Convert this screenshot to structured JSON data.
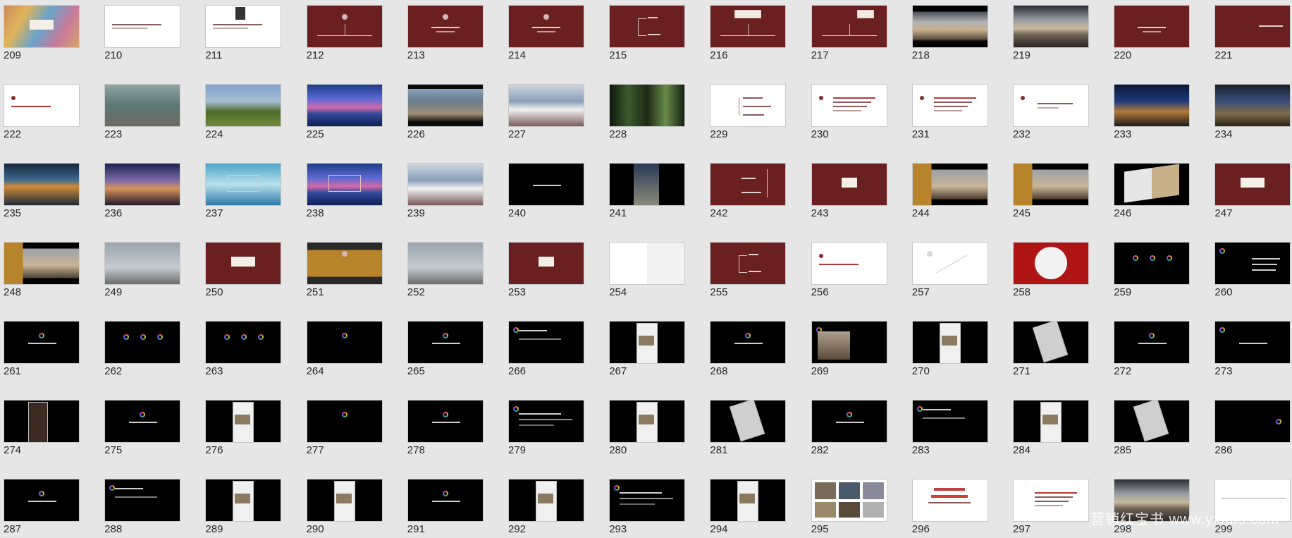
{
  "slides": [
    {
      "n": "209",
      "s": "colorful",
      "o": [
        "label-c"
      ]
    },
    {
      "n": "210",
      "s": "white",
      "o": [
        "text-l"
      ]
    },
    {
      "n": "211",
      "s": "white",
      "o": [
        "text-l",
        "photo-r"
      ]
    },
    {
      "n": "212",
      "s": "maroon",
      "o": [
        "logo-c",
        "tree"
      ]
    },
    {
      "n": "213",
      "s": "maroon",
      "o": [
        "logo-c",
        "text-c"
      ]
    },
    {
      "n": "214",
      "s": "maroon",
      "o": [
        "logo-c",
        "text-c"
      ]
    },
    {
      "n": "215",
      "s": "maroon",
      "o": [
        "branch"
      ]
    },
    {
      "n": "216",
      "s": "maroon",
      "o": [
        "box-top",
        "tree"
      ]
    },
    {
      "n": "217",
      "s": "maroon",
      "o": [
        "box-r",
        "tree"
      ]
    },
    {
      "n": "218",
      "s": "mtnblack",
      "o": []
    },
    {
      "n": "219",
      "s": "mountain",
      "o": []
    },
    {
      "n": "220",
      "s": "maroon",
      "o": [
        "text-c"
      ]
    },
    {
      "n": "221",
      "s": "maroon",
      "o": [
        "text-r"
      ]
    },
    {
      "n": "222",
      "s": "white",
      "o": [
        "logo-dark-l",
        "text-dark-l"
      ]
    },
    {
      "n": "223",
      "s": "bird",
      "o": []
    },
    {
      "n": "224",
      "s": "castle",
      "o": []
    },
    {
      "n": "225",
      "s": "sea",
      "o": []
    },
    {
      "n": "226",
      "s": "village",
      "o": []
    },
    {
      "n": "227",
      "s": "cloud",
      "o": []
    },
    {
      "n": "228",
      "s": "forest",
      "o": []
    },
    {
      "n": "229",
      "s": "white",
      "o": [
        "branch-dark"
      ]
    },
    {
      "n": "230",
      "s": "white",
      "o": [
        "logo-dark-l",
        "text-dark-multi"
      ]
    },
    {
      "n": "231",
      "s": "white",
      "o": [
        "logo-dark-l",
        "text-dark-multi"
      ]
    },
    {
      "n": "232",
      "s": "white",
      "o": [
        "logo-dark-l",
        "text-dark-c"
      ]
    },
    {
      "n": "233",
      "s": "night",
      "o": []
    },
    {
      "n": "234",
      "s": "town",
      "o": []
    },
    {
      "n": "235",
      "s": "lake",
      "o": []
    },
    {
      "n": "236",
      "s": "dusk",
      "o": []
    },
    {
      "n": "237",
      "s": "cyan",
      "o": [
        "box-c"
      ]
    },
    {
      "n": "238",
      "s": "sea",
      "o": [
        "box-c"
      ]
    },
    {
      "n": "239",
      "s": "cloud",
      "o": []
    },
    {
      "n": "240",
      "s": "black",
      "o": [
        "text-w-c"
      ]
    },
    {
      "n": "241",
      "s": "black",
      "o": [
        "photo-c"
      ]
    },
    {
      "n": "242",
      "s": "maroon",
      "o": [
        "branch-r"
      ]
    },
    {
      "n": "243",
      "s": "maroon",
      "o": [
        "label-l"
      ]
    },
    {
      "n": "244",
      "s": "mtn-gold",
      "o": []
    },
    {
      "n": "245",
      "s": "mtn-gold",
      "o": []
    },
    {
      "n": "246",
      "s": "book",
      "o": [
        "book"
      ]
    },
    {
      "n": "247",
      "s": "maroon",
      "o": [
        "label-c"
      ]
    },
    {
      "n": "248",
      "s": "mtn-gold",
      "o": []
    },
    {
      "n": "249",
      "s": "billboard",
      "o": []
    },
    {
      "n": "250",
      "s": "maroon",
      "o": [
        "label-c"
      ]
    },
    {
      "n": "251",
      "s": "gold",
      "o": [
        "logo-c"
      ]
    },
    {
      "n": "252",
      "s": "billboard",
      "o": []
    },
    {
      "n": "253",
      "s": "maroon",
      "o": [
        "label-l"
      ]
    },
    {
      "n": "254",
      "s": "paper",
      "o": []
    },
    {
      "n": "255",
      "s": "maroon",
      "o": [
        "branch"
      ]
    },
    {
      "n": "256",
      "s": "white",
      "o": [
        "logo-dark-l",
        "text-dark-l"
      ]
    },
    {
      "n": "257",
      "s": "white",
      "o": [
        "diag"
      ]
    },
    {
      "n": "258",
      "s": "redplate",
      "o": [
        "plate"
      ]
    },
    {
      "n": "259",
      "s": "black",
      "o": [
        "dots3"
      ]
    },
    {
      "n": "260",
      "s": "black",
      "o": [
        "dot-l",
        "text-w-r"
      ]
    },
    {
      "n": "261",
      "s": "black",
      "o": [
        "dot-c",
        "text-w-c"
      ]
    },
    {
      "n": "262",
      "s": "black",
      "o": [
        "dots3"
      ]
    },
    {
      "n": "263",
      "s": "black",
      "o": [
        "dots3"
      ]
    },
    {
      "n": "264",
      "s": "black",
      "o": [
        "dot-c"
      ]
    },
    {
      "n": "265",
      "s": "black",
      "o": [
        "dot-c",
        "text-w-c"
      ]
    },
    {
      "n": "266",
      "s": "black",
      "o": [
        "dot-l",
        "text-w-l"
      ]
    },
    {
      "n": "267",
      "s": "black",
      "o": [
        "phone"
      ]
    },
    {
      "n": "268",
      "s": "black",
      "o": [
        "dot-c",
        "text-w-c"
      ]
    },
    {
      "n": "269",
      "s": "black",
      "o": [
        "dot-l",
        "photo-l"
      ]
    },
    {
      "n": "270",
      "s": "black",
      "o": [
        "phone"
      ]
    },
    {
      "n": "271",
      "s": "black",
      "o": [
        "phone-tilt"
      ]
    },
    {
      "n": "272",
      "s": "black",
      "o": [
        "dot-c",
        "text-w-c"
      ]
    },
    {
      "n": "273",
      "s": "black",
      "o": [
        "dot-l",
        "text-w-c"
      ]
    },
    {
      "n": "274",
      "s": "black",
      "o": [
        "phone-l"
      ]
    },
    {
      "n": "275",
      "s": "black",
      "o": [
        "dot-c",
        "text-w-c"
      ]
    },
    {
      "n": "276",
      "s": "black",
      "o": [
        "phone"
      ]
    },
    {
      "n": "277",
      "s": "black",
      "o": [
        "dot-c"
      ]
    },
    {
      "n": "278",
      "s": "black",
      "o": [
        "dot-c",
        "text-w-c"
      ]
    },
    {
      "n": "279",
      "s": "black",
      "o": [
        "dot-l",
        "text-w-multi"
      ]
    },
    {
      "n": "280",
      "s": "black",
      "o": [
        "phone"
      ]
    },
    {
      "n": "281",
      "s": "black",
      "o": [
        "phone-tilt"
      ]
    },
    {
      "n": "282",
      "s": "black",
      "o": [
        "dot-c",
        "text-w-c"
      ]
    },
    {
      "n": "283",
      "s": "black",
      "o": [
        "dot-l",
        "text-w-l"
      ]
    },
    {
      "n": "284",
      "s": "black",
      "o": [
        "phone"
      ]
    },
    {
      "n": "285",
      "s": "black",
      "o": [
        "phone-tilt"
      ]
    },
    {
      "n": "286",
      "s": "black",
      "o": [
        "dot-r"
      ]
    },
    {
      "n": "287",
      "s": "black",
      "o": [
        "dot-c",
        "text-w-c"
      ]
    },
    {
      "n": "288",
      "s": "black",
      "o": [
        "dot-l",
        "text-w-l"
      ]
    },
    {
      "n": "289",
      "s": "black",
      "o": [
        "phone"
      ]
    },
    {
      "n": "290",
      "s": "black",
      "o": [
        "phone"
      ]
    },
    {
      "n": "291",
      "s": "black",
      "o": [
        "dot-c",
        "text-w-c"
      ]
    },
    {
      "n": "292",
      "s": "black",
      "o": [
        "phone"
      ]
    },
    {
      "n": "293",
      "s": "black",
      "o": [
        "dot-l",
        "text-w-multi"
      ]
    },
    {
      "n": "294",
      "s": "black",
      "o": [
        "phone"
      ]
    },
    {
      "n": "295",
      "s": "white",
      "o": [
        "collage"
      ]
    },
    {
      "n": "296",
      "s": "white",
      "o": [
        "box-c-dark"
      ]
    },
    {
      "n": "297",
      "s": "white",
      "o": [
        "text-dark-multi"
      ]
    },
    {
      "n": "298",
      "s": "mountain",
      "o": []
    },
    {
      "n": "299",
      "s": "white",
      "o": [
        "line-h"
      ]
    }
  ],
  "watermark": "营销红宝书 www.yxhbs.com"
}
